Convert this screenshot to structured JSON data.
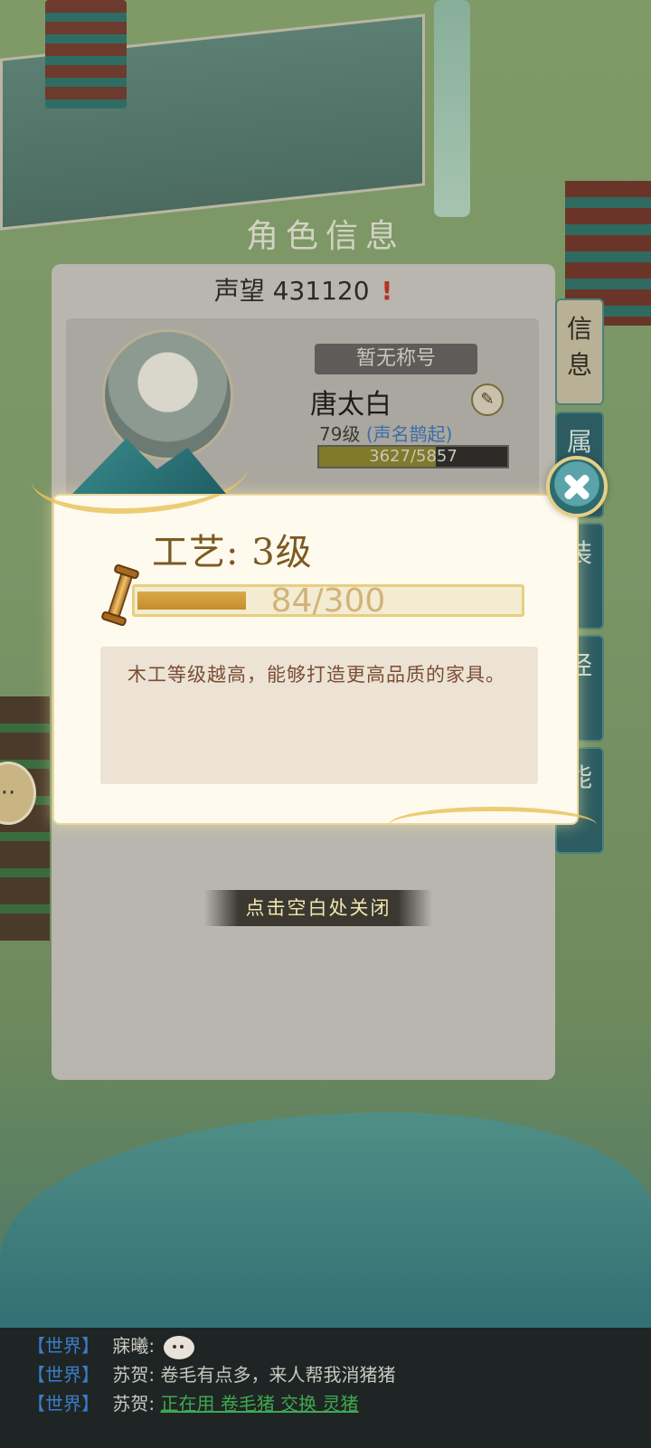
{
  "panel": {
    "title": "角色信息",
    "prestige_label": "声望",
    "prestige_value": "431120",
    "prestige_alert": "!",
    "title_badge": "暂无称号",
    "char_name": "唐太白",
    "char_level": "79级",
    "char_fame": "(声名鹊起)",
    "exp_text": "3627/5857",
    "exp_fraction": 0.619,
    "side_tabs": [
      "信息",
      "属",
      "装",
      "经",
      "能"
    ]
  },
  "popup": {
    "skill_title": "工艺: 3级",
    "progress_text": "84/300",
    "progress_fraction": 0.28,
    "description": "木工等级越高，能够打造更高品质的家具。",
    "close_hint": "点击空白处关闭"
  },
  "chat": {
    "lines": [
      {
        "channel": "【世界】",
        "speaker": "寐曦:",
        "message": "",
        "has_emoji": true,
        "link": false
      },
      {
        "channel": "【世界】",
        "speaker": "苏贺:",
        "message": "卷毛有点多，来人帮我消猪猪",
        "has_emoji": false,
        "link": false
      },
      {
        "channel": "【世界】",
        "speaker": "苏贺:",
        "message": "正在用 卷毛猪 交换 灵猪",
        "has_emoji": false,
        "link": true
      }
    ]
  },
  "colors": {
    "popup_bg": "#fffaee",
    "progress_fill": "#c58d2e",
    "description_text": "#7a4e33",
    "chat_channel": "#3a7dc7",
    "chat_link": "#3fa84f"
  }
}
